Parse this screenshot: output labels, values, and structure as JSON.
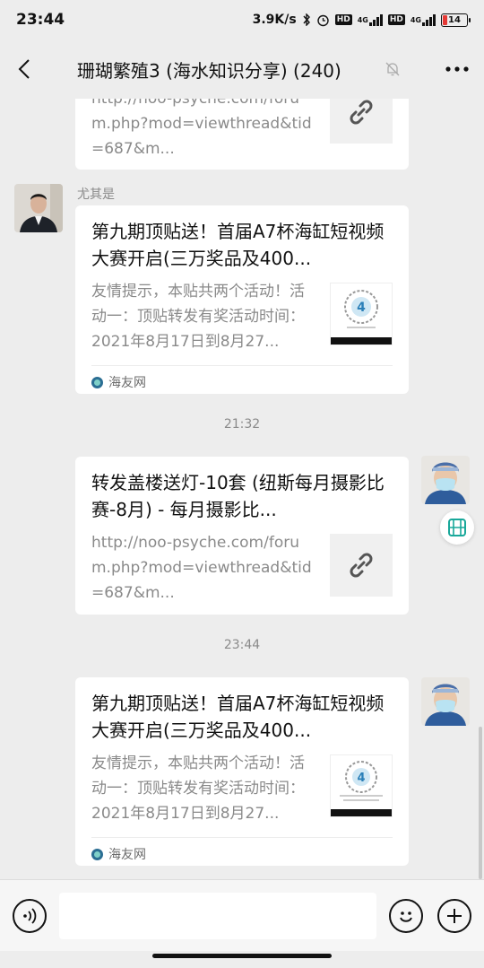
{
  "status_bar": {
    "time": "23:44",
    "net_speed": "3.9K/s",
    "hd1": "HD",
    "hd2": "HD",
    "net1": "4G",
    "net2": "4G",
    "battery": "14"
  },
  "header": {
    "title": "珊瑚繁殖3 (海水知识分享) (240)"
  },
  "messages": [
    {
      "card_desc": "http://noo-psyche.com/forum.php?mod=viewthread&tid=687&m..."
    },
    {
      "sender": "尤其是",
      "card_title": "第九期顶贴送！首届A7杯海缸短视频大赛开启(三万奖品及400...",
      "card_desc": "友情提示，本贴共两个活动！活动一：顶贴转发有奖活动时间：2021年8月17日到8月27...",
      "source": "海友网"
    },
    {
      "time": "21:32"
    },
    {
      "card_title": "转发盖楼送灯-10套 (纽斯每月摄影比赛-8月) - 每月摄影比...",
      "card_desc": "http://noo-psyche.com/forum.php?mod=viewthread&tid=687&m..."
    },
    {
      "time": "23:44"
    },
    {
      "card_title": "第九期顶贴送！首届A7杯海缸短视频大赛开启(三万奖品及400...",
      "card_desc": "友情提示，本贴共两个活动！活动一：顶贴转发有奖活动时间：2021年8月17日到8月27...",
      "source": "海友网"
    }
  ],
  "input": {
    "value": ""
  },
  "colors": {
    "background": "#ededed",
    "card": "#ffffff",
    "battery_low": "#e53935",
    "float_accent": "#19a89a"
  },
  "icons": [
    "back-arrow-icon",
    "mute-bell-icon",
    "more-icon",
    "link-icon",
    "voice-icon",
    "emoji-icon",
    "plus-icon",
    "float-window-icon"
  ]
}
